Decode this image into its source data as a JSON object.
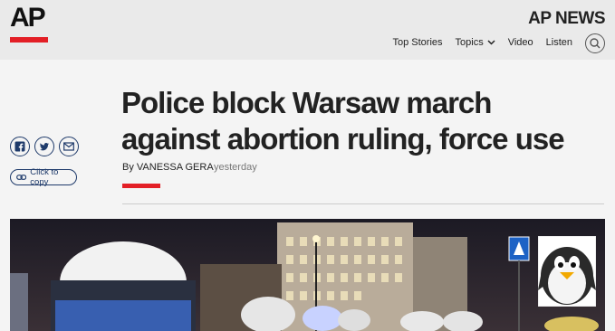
{
  "header": {
    "logo_text": "AP",
    "brand": "AP NEWS",
    "nav": [
      {
        "label": "Top Stories"
      },
      {
        "label": "Topics"
      },
      {
        "label": "Video"
      },
      {
        "label": "Listen"
      }
    ]
  },
  "share": {
    "copy_label": "Click to copy"
  },
  "article": {
    "headline": "Police block Warsaw march against abortion ruling, force use",
    "byline": "By VANESSA GERA",
    "time": "yesterday"
  },
  "colors": {
    "accent": "#e31f26",
    "share_blue": "#1e3a6a"
  },
  "icons": [
    "facebook-icon",
    "twitter-icon",
    "email-icon",
    "link-icon",
    "search-icon",
    "chevron-down-icon"
  ]
}
